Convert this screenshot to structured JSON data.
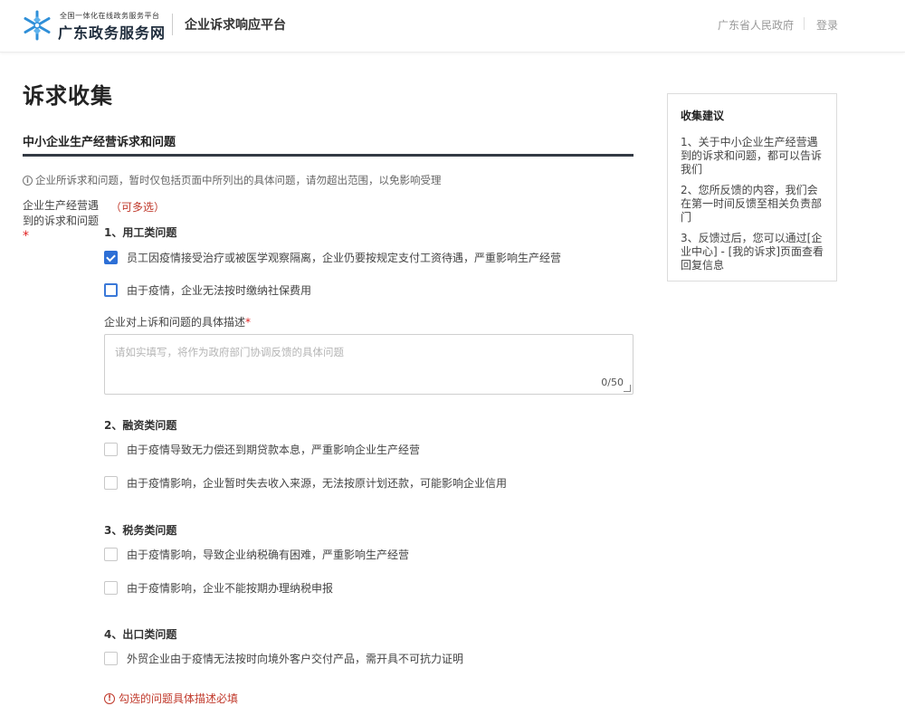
{
  "header": {
    "brand_small": "全国一体化在线政务服务平台",
    "brand_name": "广东政务服务网",
    "platform_title": "企业诉求响应平台",
    "gov_link": "广东省人民政府",
    "login": "登录",
    "logo_color": "#2f8fd8"
  },
  "page": {
    "title": "诉求收集",
    "section_title": "中小企业生产经营诉求和问题",
    "notice": "企业所诉求和问题，暂时仅包括页面中所列出的具体问题，请勿超出范围，以免影响受理"
  },
  "form": {
    "field_label": "企业生产经营遇到的诉求和问题",
    "required_mark": "*",
    "multi_hint": "（可多选）",
    "categories": [
      {
        "title": "1、用工类问题",
        "options": [
          {
            "label": "员工因疫情接受治疗或被医学观察隔离，企业仍要按规定支付工资待遇，严重影响生产经营",
            "checked": true
          },
          {
            "label": "由于疫情，企业无法按时缴纳社保费用",
            "checked": false
          }
        ]
      },
      {
        "title": "2、融资类问题",
        "options": [
          {
            "label": "由于疫情导致无力偿还到期贷款本息，严重影响企业生产经营",
            "checked": false
          },
          {
            "label": "由于疫情影响，企业暂时失去收入来源，无法按原计划还款，可能影响企业信用",
            "checked": false
          }
        ]
      },
      {
        "title": "3、税务类问题",
        "options": [
          {
            "label": "由于疫情影响，导致企业纳税确有困难，严重影响生产经营",
            "checked": false
          },
          {
            "label": "由于疫情影响，企业不能按期办理纳税申报",
            "checked": false
          }
        ]
      },
      {
        "title": "4、出口类问题",
        "options": [
          {
            "label": "外贸企业由于疫情无法按时向境外客户交付产品，需开具不可抗力证明",
            "checked": false
          }
        ]
      }
    ],
    "description": {
      "label": "企业对上诉和问题的具体描述",
      "placeholder": "请如实填写，将作为政府部门协调反馈的具体问题",
      "value": "",
      "counter": "0/50"
    },
    "error": "勾选的问题具体描述必填"
  },
  "tips": {
    "title": "收集建议",
    "items": [
      "1、关于中小企业生产经营遇到的诉求和问题，都可以告诉我们",
      "2、您所反馈的内容，我们会在第一时间反馈至相关负责部门",
      "3、反馈过后，您可以通过[企业中心] - [我的诉求]页面查看回复信息"
    ]
  }
}
